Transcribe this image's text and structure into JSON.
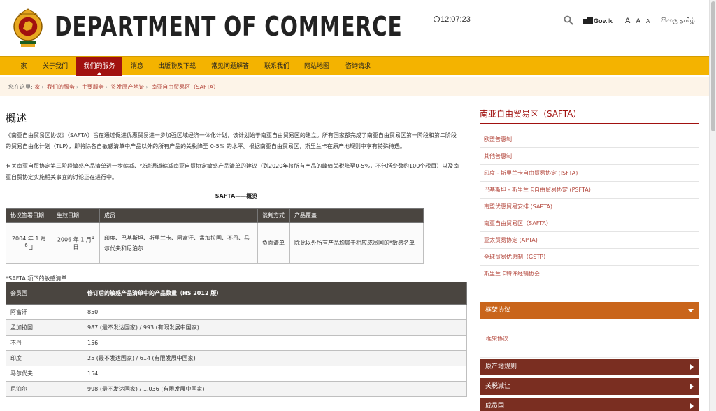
{
  "header": {
    "site_title": "DEPARTMENT OF COMMERCE",
    "clock": "12:07:23",
    "gov_logo": "Gov.lk",
    "font_sizes": [
      "A",
      "A",
      "A"
    ],
    "languages": [
      "සිංහල",
      "தமிழ்"
    ]
  },
  "nav": {
    "items": [
      {
        "label": "家"
      },
      {
        "label": "关于我们"
      },
      {
        "label": "我们的服务"
      },
      {
        "label": "消息"
      },
      {
        "label": "出版物及下载"
      },
      {
        "label": "常见问题解答"
      },
      {
        "label": "联系我们"
      },
      {
        "label": "网站地图"
      },
      {
        "label": "咨询请求"
      }
    ]
  },
  "breadcrumb": {
    "prefix": "您在这里:",
    "items": [
      "家",
      "我们的服务",
      "主要服务",
      "签发原产地证",
      "南亚自由贸易区（SAFTA）"
    ]
  },
  "main": {
    "title": "概述",
    "para1": "《南亚自由贸易区协议》（SAFTA）旨在通过促进优惠贸易进一步加强区域经济一体化计划，该计划始于南亚自由贸易区的建立。所有国家都完成了南亚自由贸易区第一阶段和第二阶段的贸易自由化计划（TLP），即将除各自敏感清单中产品以外的所有产品的关税降至 0-5% 的水平。根据南亚自由贸易区，斯里兰卡在原产地规则中享有特殊待遇。",
    "para2": "有关南亚自贸协定第三阶段敏感产品清单进一步缩减、快速通道缩减南亚自贸协定敏感产品清单的建议（到2020年将所有产品的峰值关税降至0-5%，不包括少数约100个税目）以及南亚自贸协定实施相关事宜的讨论正在进行中。",
    "caption": "SAFTA——概览",
    "overview_table": {
      "headers": [
        "协议签署日期",
        "生效日期",
        "成员",
        "谈判方式",
        "产品覆盖"
      ],
      "row": {
        "sign_date": "2004 年 1 月",
        "sign_sup": "6",
        "sign_suffix": "日",
        "effective_date": "2006 年 1 月",
        "effective_sup": "1",
        "effective_suffix": "日",
        "members": "印度、巴基斯坦、斯里兰卡、阿富汗、孟加拉国、不丹、马尔代夫和尼泊尔",
        "method": "负面清单",
        "coverage": "除此以外所有产品均属于相应成员国的*敏感名单"
      }
    },
    "note": "*SAFTA 项下的敏感清单",
    "sensitive_table": {
      "headers": [
        "会员国",
        "修订后的敏感产品清单中的产品数量（HS 2012 版）"
      ],
      "rows": [
        [
          "阿富汗",
          "850"
        ],
        [
          "孟加拉国",
          "987 (最不发达国家) / 993 (有限发展中国家)"
        ],
        [
          "不丹",
          "156"
        ],
        [
          "印度",
          "25 (最不发达国家) / 614 (有限发展中国家)"
        ],
        [
          "马尔代夫",
          "154"
        ],
        [
          "尼泊尔",
          "998 (最不发达国家) / 1,036 (有限发展中国家)"
        ]
      ]
    }
  },
  "sidebar": {
    "title": "南亚自由贸易区（SAFTA）",
    "links": [
      "欧盟普惠制",
      "其他普惠制",
      "印度 - 斯里兰卡自由贸易协定 (ISFTA)",
      "巴基斯坦 - 斯里兰卡自由贸易协定 (PSFTA)",
      "南盟优惠贸易安排 (SAPTA)",
      "南亚自由贸易区（SAFTA）",
      "亚太贸易协定 (APTA)",
      "全球贸易优惠制（GSTP）",
      "斯里兰卡特许经销协会"
    ],
    "accordions": [
      {
        "label": "框架协议",
        "open": true,
        "body": "框架协议"
      },
      {
        "label": "原产地规则",
        "open": false
      },
      {
        "label": "关税减让",
        "open": false
      },
      {
        "label": "成员国",
        "open": false
      }
    ]
  },
  "colors": {
    "nav_bg": "#f4b300",
    "nav_active": "#a1110f",
    "accent_red": "#a1110f",
    "accordion_open": "#c9651b",
    "accordion_closed": "#7a2e21",
    "table_header": "#4a4540"
  }
}
